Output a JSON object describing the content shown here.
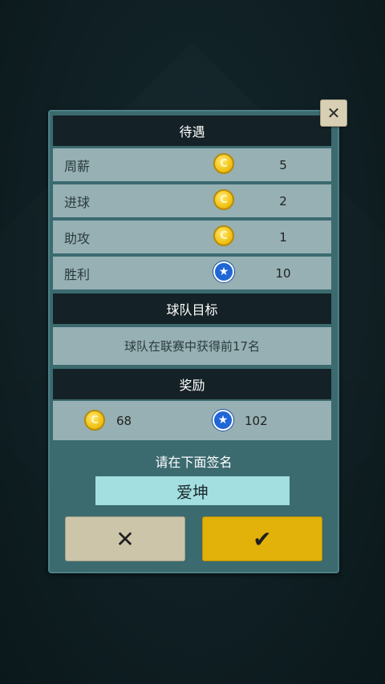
{
  "close_label": "✕",
  "contract": {
    "treatment_header": "待遇",
    "rows": [
      {
        "label": "周薪",
        "icon": "coin",
        "value": "5"
      },
      {
        "label": "进球",
        "icon": "coin",
        "value": "2"
      },
      {
        "label": "助攻",
        "icon": "coin",
        "value": "1"
      },
      {
        "label": "胜利",
        "icon": "star",
        "value": "10"
      }
    ],
    "goal_header": "球队目标",
    "goal_text": "球队在联赛中获得前17名",
    "reward_header": "奖励",
    "reward": {
      "coins": "68",
      "stars": "102"
    },
    "sign_prompt": "请在下面签名",
    "signature": "爱坤",
    "reject_label": "✕",
    "accept_label": "✔"
  },
  "icons": {
    "coin_glyph": "C",
    "star_glyph": "★"
  },
  "colors": {
    "panel": "#3b6a6f",
    "header": "#142126",
    "row": "#96b0b3",
    "accept": "#e2b10a",
    "reject": "#cdc5aa",
    "signature_bg": "#a3dfe0"
  }
}
